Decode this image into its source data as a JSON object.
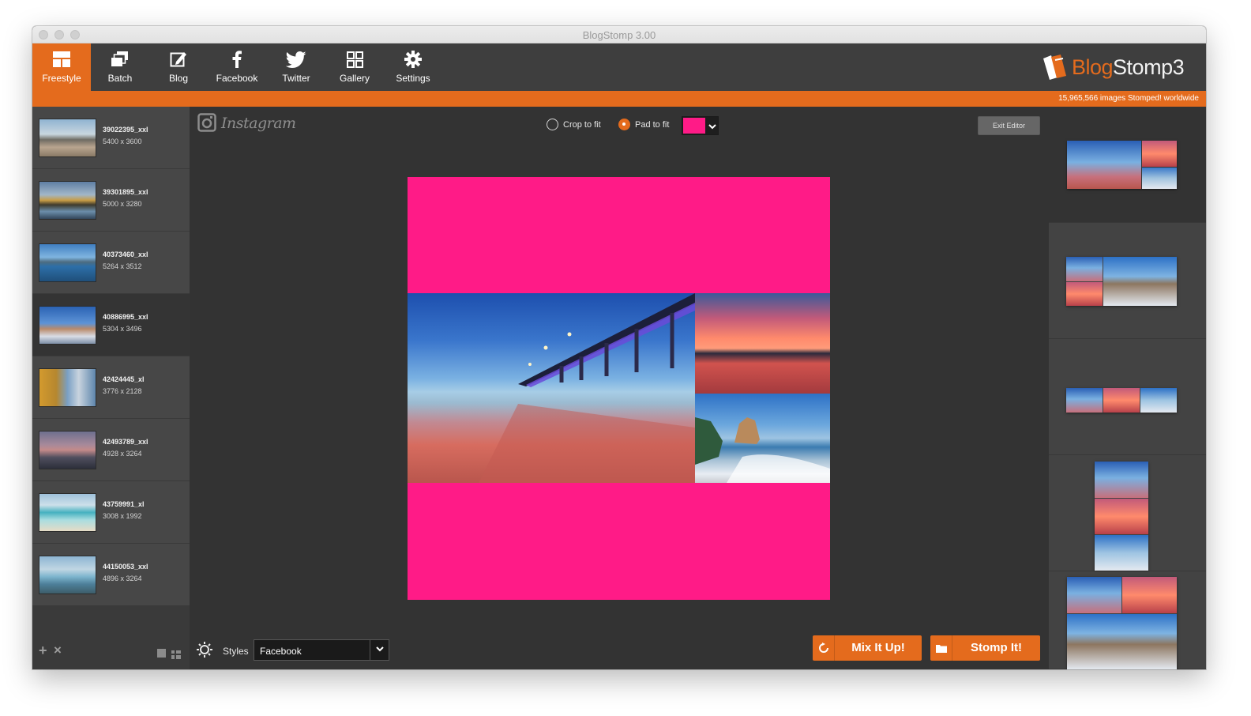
{
  "window": {
    "title": "BlogStomp 3.00"
  },
  "toolbar": {
    "items": [
      {
        "label": "Freestyle",
        "icon": "freestyle-icon",
        "active": true
      },
      {
        "label": "Batch",
        "icon": "batch-icon"
      },
      {
        "label": "Blog",
        "icon": "blog-edit-icon"
      },
      {
        "label": "Facebook",
        "icon": "facebook-icon"
      },
      {
        "label": "Twitter",
        "icon": "twitter-icon"
      },
      {
        "label": "Gallery",
        "icon": "gallery-grid-icon"
      },
      {
        "label": "Settings",
        "icon": "gear-icon"
      }
    ],
    "brand": {
      "prefix": "Blog",
      "suffix": "Stomp3"
    }
  },
  "status": {
    "stomped_count": "15,965,566 images Stomped! worldwide"
  },
  "images": [
    {
      "name": "39022395_xxl",
      "dims": "5400 x 3600"
    },
    {
      "name": "39301895_xxl",
      "dims": "5000 x 3280"
    },
    {
      "name": "40373460_xxl",
      "dims": "5264 x 3512"
    },
    {
      "name": "40886995_xxl",
      "dims": "5304 x 3496",
      "selected": true
    },
    {
      "name": "42424445_xl",
      "dims": "3776 x 2128"
    },
    {
      "name": "42493789_xxl",
      "dims": "4928 x 3264"
    },
    {
      "name": "43759991_xl",
      "dims": "3008 x 1992"
    },
    {
      "name": "44150053_xxl",
      "dims": "4896 x 3264"
    }
  ],
  "editor": {
    "preset_label": "Instagram",
    "crop_label": "Crop to fit",
    "pad_label": "Pad to fit",
    "selected_fit": "pad",
    "pad_color": "#ff1b87",
    "exit_label": "Exit Editor"
  },
  "footer": {
    "styles_label": "Styles",
    "styles_value": "Facebook",
    "mix_label": "Mix It Up!",
    "stomp_label": "Stomp It!"
  },
  "colors": {
    "accent": "#e46b1d",
    "pad": "#ff1b87"
  }
}
